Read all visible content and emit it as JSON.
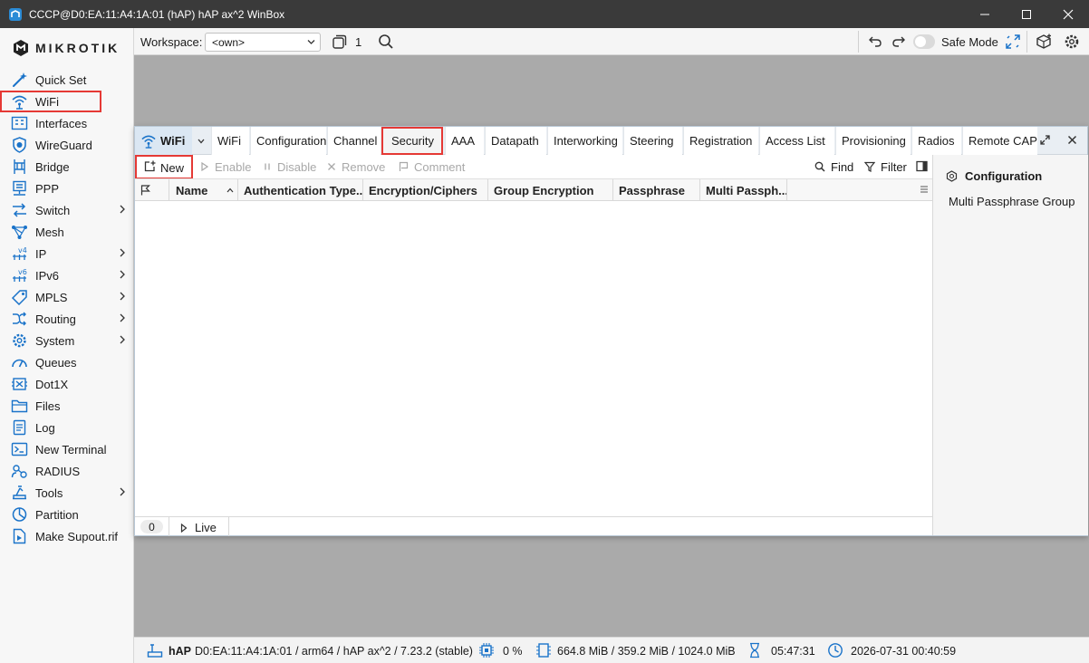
{
  "window": {
    "title": "CCCP@D0:EA:11:A4:1A:01 (hAP) hAP ax^2 WinBox"
  },
  "brand": {
    "name": "MikroTik",
    "wordmark": "MIKROTIK",
    "icon": "mikrotik-logo-icon"
  },
  "sidebar": {
    "items": [
      {
        "label": "Quick Set",
        "icon": "wand-icon",
        "submenu": false
      },
      {
        "label": "WiFi",
        "icon": "wifi-icon",
        "submenu": false,
        "selected": true
      },
      {
        "label": "Interfaces",
        "icon": "interfaces-icon",
        "submenu": false
      },
      {
        "label": "WireGuard",
        "icon": "wireguard-icon",
        "submenu": false
      },
      {
        "label": "Bridge",
        "icon": "bridge-icon",
        "submenu": false
      },
      {
        "label": "PPP",
        "icon": "ppp-icon",
        "submenu": false
      },
      {
        "label": "Switch",
        "icon": "switch-icon",
        "submenu": true
      },
      {
        "label": "Mesh",
        "icon": "mesh-icon",
        "submenu": false
      },
      {
        "label": "IP",
        "icon": "ipv4-icon",
        "submenu": true
      },
      {
        "label": "IPv6",
        "icon": "ipv6-icon",
        "submenu": true
      },
      {
        "label": "MPLS",
        "icon": "mpls-icon",
        "submenu": true
      },
      {
        "label": "Routing",
        "icon": "routing-icon",
        "submenu": true
      },
      {
        "label": "System",
        "icon": "system-gear-icon",
        "submenu": true
      },
      {
        "label": "Queues",
        "icon": "queues-icon",
        "submenu": false
      },
      {
        "label": "Dot1X",
        "icon": "dot1x-icon",
        "submenu": false
      },
      {
        "label": "Files",
        "icon": "folder-icon",
        "submenu": false
      },
      {
        "label": "Log",
        "icon": "log-icon",
        "submenu": false
      },
      {
        "label": "New Terminal",
        "icon": "terminal-icon",
        "submenu": false
      },
      {
        "label": "RADIUS",
        "icon": "radius-icon",
        "submenu": false
      },
      {
        "label": "Tools",
        "icon": "tools-icon",
        "submenu": true
      },
      {
        "label": "Partition",
        "icon": "partition-icon",
        "submenu": false
      },
      {
        "label": "Make Supout.rif",
        "icon": "supout-icon",
        "submenu": false
      }
    ]
  },
  "topbar": {
    "workspace_label": "Workspace:",
    "workspace_value": "<own>",
    "window_count": "1",
    "safe_mode_label": "Safe Mode",
    "safe_mode_on": false
  },
  "wifi_window": {
    "head_label": "WiFi",
    "tabs": [
      {
        "label": "WiFi"
      },
      {
        "label": "Configuration"
      },
      {
        "label": "Channel"
      },
      {
        "label": "Security",
        "selected": true
      },
      {
        "label": "AAA"
      },
      {
        "label": "Datapath"
      },
      {
        "label": "Interworking"
      },
      {
        "label": "Steering"
      },
      {
        "label": "Registration"
      },
      {
        "label": "Access List"
      },
      {
        "label": "Provisioning"
      },
      {
        "label": "Radios"
      },
      {
        "label": "Remote CAP"
      }
    ],
    "toolbar": {
      "new_label": "New",
      "enable_label": "Enable",
      "disable_label": "Disable",
      "remove_label": "Remove",
      "comment_label": "Comment",
      "find_label": "Find",
      "filter_label": "Filter"
    },
    "columns": [
      "Name",
      "Authentication Type...",
      "Encryption/Ciphers",
      "Group Encryption",
      "Passphrase",
      "Multi Passph..."
    ],
    "rows": [],
    "footer": {
      "count": "0",
      "live_label": "Live"
    },
    "side_panel": {
      "title": "Configuration",
      "items": [
        "Multi Passphrase Group"
      ]
    }
  },
  "statusbar": {
    "device": "hAP",
    "info": "D0:EA:11:A4:1A:01 / arm64 / hAP ax^2 / 7.23.2 (stable)",
    "cpu": "0 %",
    "memory": "664.8 MiB / 359.2 MiB / 1024.0 MiB",
    "uptime": "05:47:31",
    "datetime": "2026-07-31 00:40:59"
  },
  "colors": {
    "highlight": "#e53935",
    "accent": "#1a73c9",
    "titlebar": "#3a3a3a",
    "workspace": "#aaaaaa"
  }
}
